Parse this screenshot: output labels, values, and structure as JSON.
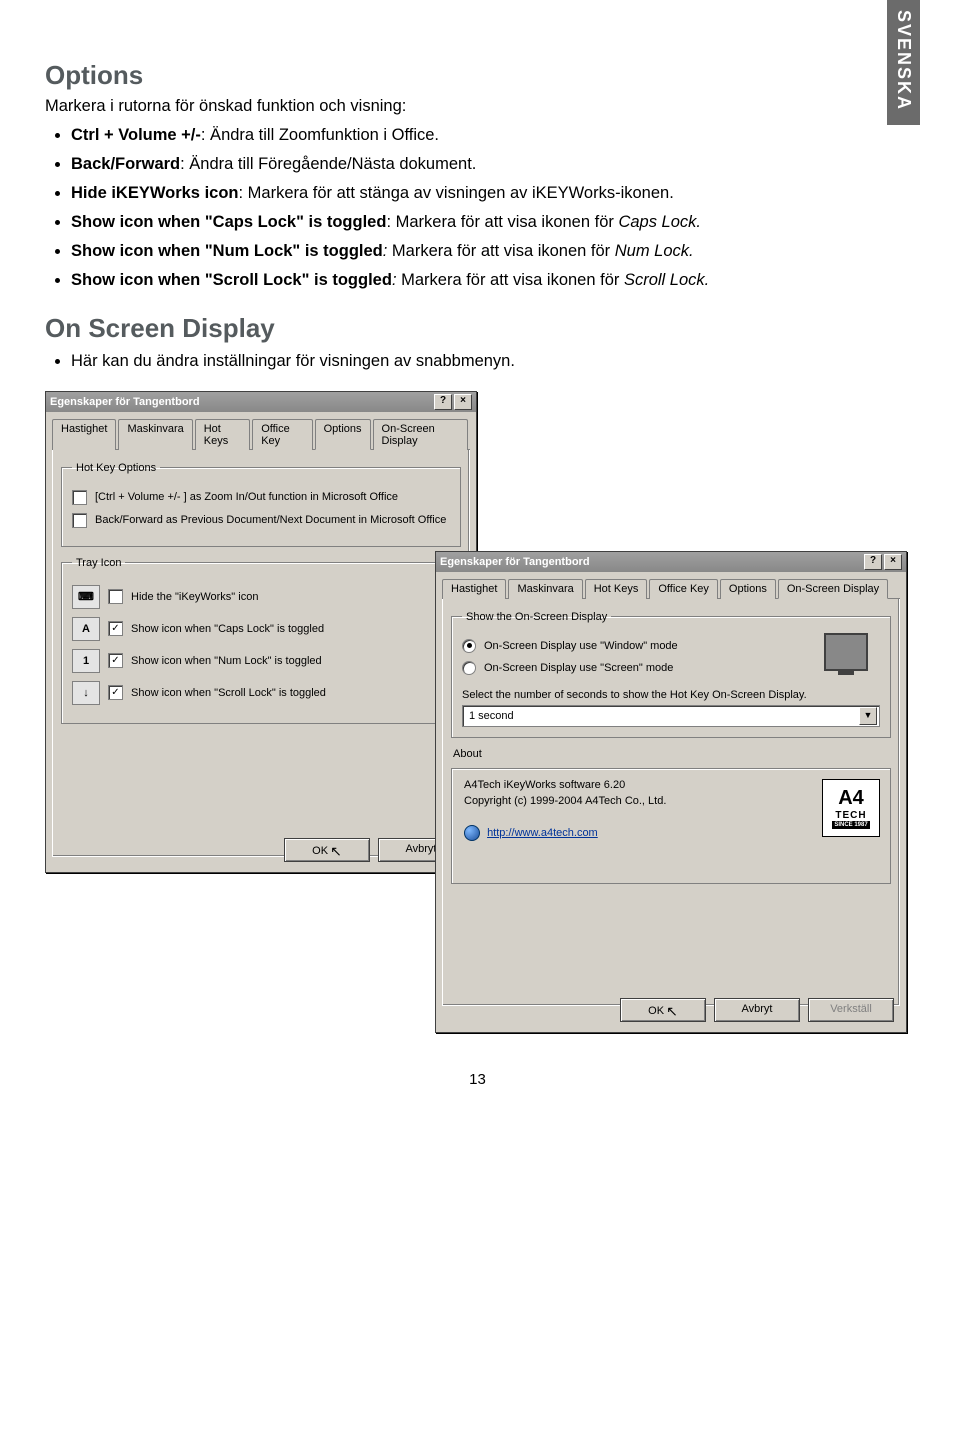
{
  "sideTab": "SVENSKA",
  "section1": {
    "title": "Options",
    "intro": "Markera i rutorna för önskad funktion och visning:",
    "items": [
      {
        "bold": "Ctrl + Volume +/-",
        "rest": ": Ändra till Zoomfunktion i Office."
      },
      {
        "bold": "Back/Forward",
        "rest": ": Ändra till Föregående/Nästa dokument."
      },
      {
        "bold": "Hide iKEYWorks icon",
        "rest": ": Markera för att stänga av visningen av iKEYWorks-ikonen."
      },
      {
        "bold": "Show icon when \"Caps Lock\" is toggled",
        "rest": ": Markera för att visa ikonen för ",
        "ital": "Caps Lock."
      },
      {
        "bold": "Show icon when \"Num Lock\" is toggled",
        "italLead": ": ",
        "rest": "Markera för att visa ikonen för ",
        "ital": "Num Lock."
      },
      {
        "bold": "Show icon when \"Scroll Lock\" is toggled",
        "italLead": ": ",
        "rest": "Markera för att visa ikonen för ",
        "ital": "Scroll Lock."
      }
    ]
  },
  "section2": {
    "title": "On Screen Display",
    "items": [
      {
        "rest": "Här kan du ändra inställningar för visningen av snabbmenyn."
      }
    ]
  },
  "dialog1": {
    "title": "Egenskaper för Tangentbord",
    "help": "?",
    "close": "×",
    "tabs": [
      "Hastighet",
      "Maskinvara",
      "Hot Keys",
      "Office Key",
      "Options",
      "On-Screen Display"
    ],
    "activeTab": "Options",
    "group1": {
      "legend": "Hot Key Options",
      "opt1": "[Ctrl + Volume +/- ] as Zoom In/Out function in Microsoft Office",
      "opt2": "Back/Forward as Previous Document/Next Document in Microsoft Office"
    },
    "group2": {
      "legend": "Tray Icon",
      "rows": [
        {
          "icon": "⌨",
          "checked": false,
          "label": "Hide the \"iKeyWorks\" icon"
        },
        {
          "icon": "A",
          "checked": true,
          "label": "Show icon when \"Caps Lock\" is toggled"
        },
        {
          "icon": "1",
          "checked": true,
          "label": "Show icon when \"Num Lock\" is toggled"
        },
        {
          "icon": "↓",
          "checked": true,
          "label": "Show icon when \"Scroll Lock\" is toggled"
        }
      ]
    },
    "ok": "OK",
    "cancel": "Avbryt"
  },
  "dialog2": {
    "title": "Egenskaper för Tangentbord",
    "help": "?",
    "close": "×",
    "tabs": [
      "Hastighet",
      "Maskinvara",
      "Hot Keys",
      "Office Key",
      "Options",
      "On-Screen Display"
    ],
    "activeTab": "On-Screen Display",
    "group": {
      "legend": "Show the On-Screen Display",
      "radio1": "On-Screen Display use \"Window\" mode",
      "radio2": "On-Screen Display use \"Screen\" mode",
      "secondsLabel": "Select the number of seconds to show the Hot Key On-Screen Display.",
      "selectValue": "1 second"
    },
    "about": {
      "legend": "About",
      "line1": "A4Tech iKeyWorks software 6.20",
      "line2": "Copyright (c) 1999-2004 A4Tech Co., Ltd.",
      "url": "http://www.a4tech.com",
      "logoTop": "A4",
      "logoMid": "TECH",
      "logoBot": "SINCE 1987"
    },
    "ok": "OK",
    "cancel": "Avbryt",
    "apply": "Verkställ"
  },
  "pageNum": "13"
}
